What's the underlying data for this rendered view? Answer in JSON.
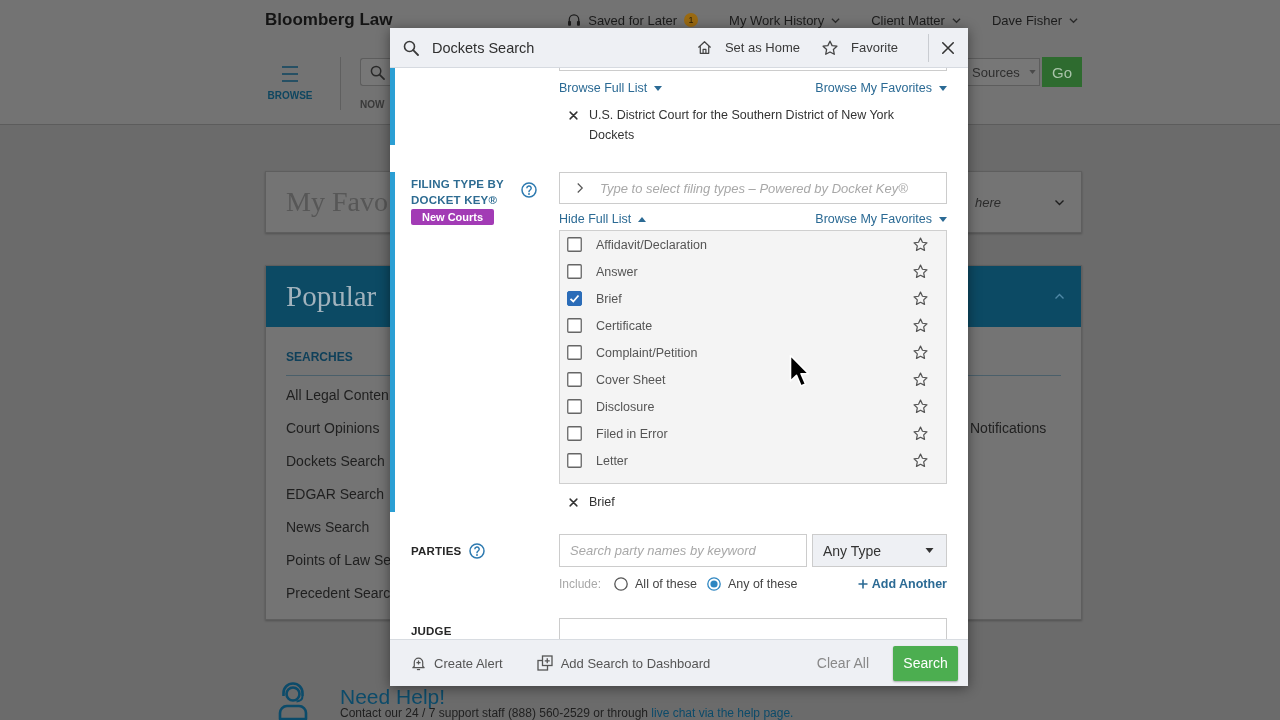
{
  "page": {
    "header": {
      "logo": "Bloomberg Law",
      "saved": {
        "label": "Saved for Later",
        "count": "1"
      },
      "menus": [
        {
          "label": "My Work History"
        },
        {
          "label": "Client Matter"
        },
        {
          "label": "Dave Fisher"
        }
      ]
    },
    "toolbar": {
      "browse": "BROWSE",
      "scope": "NOW",
      "sources": "Sources",
      "go": "Go"
    },
    "favorites_card": {
      "title": "My Favo",
      "hint": "here",
      "expanded": false
    },
    "popular_card": {
      "title": "Popular",
      "expanded": true,
      "heading": "SEARCHES",
      "items": [
        "All Legal Conten",
        "Court Opinions",
        "Dockets Search",
        "EDGAR Search",
        "News Search",
        "Points of Law Se",
        "Precedent Searc"
      ],
      "column_3": [
        "Notifications"
      ]
    },
    "help": {
      "title": "Need Help!",
      "text": "Contact our 24 / 7 support staff (888) 560-2529 or through ",
      "link": "live chat via the help page."
    }
  },
  "modal": {
    "title": "Dockets Search",
    "actions": [
      {
        "kind": "home",
        "label": "Set as Home"
      },
      {
        "kind": "favorite",
        "label": "Favorite"
      }
    ],
    "sections": [
      {
        "kind": "court",
        "active": true,
        "browse": [
          {
            "label": "Browse Full List",
            "expanded": false
          },
          {
            "label": "Browse My Favorites",
            "expanded": false
          }
        ],
        "selected": [
          "U.S. District Court for the Southern District of New York Dockets"
        ]
      },
      {
        "kind": "filing_type",
        "active": true,
        "label": "FILING TYPE BY DOCKET KEY®",
        "help": true,
        "badge": "New Courts",
        "placeholder": "Type to select filing types – Powered by Docket Key®",
        "browse": [
          {
            "label": "Hide Full List",
            "expanded": true
          },
          {
            "label": "Browse My Favorites",
            "expanded": false
          }
        ],
        "options": [
          {
            "label": "Affidavit/Declaration",
            "checked": false,
            "favorite": false
          },
          {
            "label": "Answer",
            "checked": false,
            "favorite": false
          },
          {
            "label": "Brief",
            "checked": true,
            "favorite": false
          },
          {
            "label": "Certificate",
            "checked": false,
            "favorite": false
          },
          {
            "label": "Complaint/Petition",
            "checked": false,
            "favorite": false
          },
          {
            "label": "Cover Sheet",
            "checked": false,
            "favorite": false
          },
          {
            "label": "Disclosure",
            "checked": false,
            "favorite": false
          },
          {
            "label": "Filed in Error",
            "checked": false,
            "favorite": false
          },
          {
            "label": "Letter",
            "checked": false,
            "favorite": false
          }
        ],
        "selected": [
          "Brief"
        ]
      },
      {
        "kind": "parties",
        "active": false,
        "label": "PARTIES",
        "help": true,
        "placeholder": "Search party names by keyword",
        "type": "Any Type",
        "include_label": "Include:",
        "include": [
          {
            "label": "All of these",
            "selected": false
          },
          {
            "label": "Any of these",
            "selected": true
          }
        ],
        "add": "Add Another"
      },
      {
        "kind": "judge",
        "active": false,
        "label": "JUDGE",
        "help": false
      }
    ],
    "footer": {
      "actions": [
        {
          "kind": "alert",
          "label": "Create Alert"
        },
        {
          "kind": "dashboard",
          "label": "Add Search to Dashboard"
        }
      ],
      "clear": "Clear All",
      "submit": "Search"
    }
  }
}
